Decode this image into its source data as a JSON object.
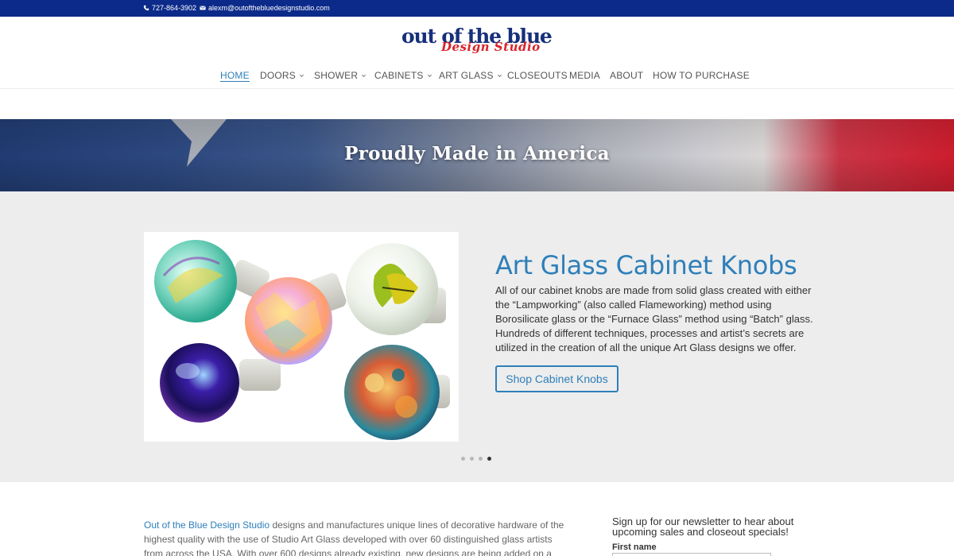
{
  "topbar": {
    "phone": "727-864-3902",
    "email": "alexm@outofthebluedesignstudio.com"
  },
  "logo": {
    "line1": "out of the blue",
    "line2": "Design Studio"
  },
  "nav": {
    "items": [
      {
        "label": "HOME",
        "active": true,
        "dropdown": false
      },
      {
        "label": "DOORS",
        "dropdown": true
      },
      {
        "label": "SHOWER",
        "dropdown": true
      },
      {
        "label": "CABINETS",
        "dropdown": true
      },
      {
        "label": "ART GLASS",
        "dropdown": true
      },
      {
        "label": "CLOSEOUTS",
        "dropdown": false
      },
      {
        "label": "MEDIA",
        "dropdown": false
      },
      {
        "label": "ABOUT",
        "dropdown": false
      },
      {
        "label": "HOW TO PURCHASE",
        "dropdown": false
      }
    ]
  },
  "banner": {
    "title": "Proudly Made in America"
  },
  "slider": {
    "title": "Art Glass Cabinet Knobs",
    "text": "All of our cabinet knobs are made from solid glass created with either the “Lampworking” (also called Flameworking) method using Borosilicate glass or the “Furnace Glass” method using “Batch” glass. Hundreds of different techniques, processes and artist’s secrets are utilized in the creation of all the unique Art Glass designs we offer.",
    "button": "Shop Cabinet Knobs",
    "slide_count": 4,
    "active_slide": 4
  },
  "intro": {
    "brand": "Out of the Blue Design Studio",
    "text": " designs and manufactures unique lines of decorative hardware of the highest quality with the use of Studio Art Glass developed with over 60 distinguished glass artists from across the USA. With over 600 designs already existing, new designs are being added on a continual basis, as"
  },
  "newsletter": {
    "title": "Sign up for our newsletter to hear about upcoming sales and closeout specials!",
    "first_name_label": "First name",
    "first_name_value": ""
  },
  "colors": {
    "topbar": "#0c2a8a",
    "accent": "#2e7fb9",
    "logo_blue": "#17307a",
    "logo_red": "#d8232a"
  }
}
